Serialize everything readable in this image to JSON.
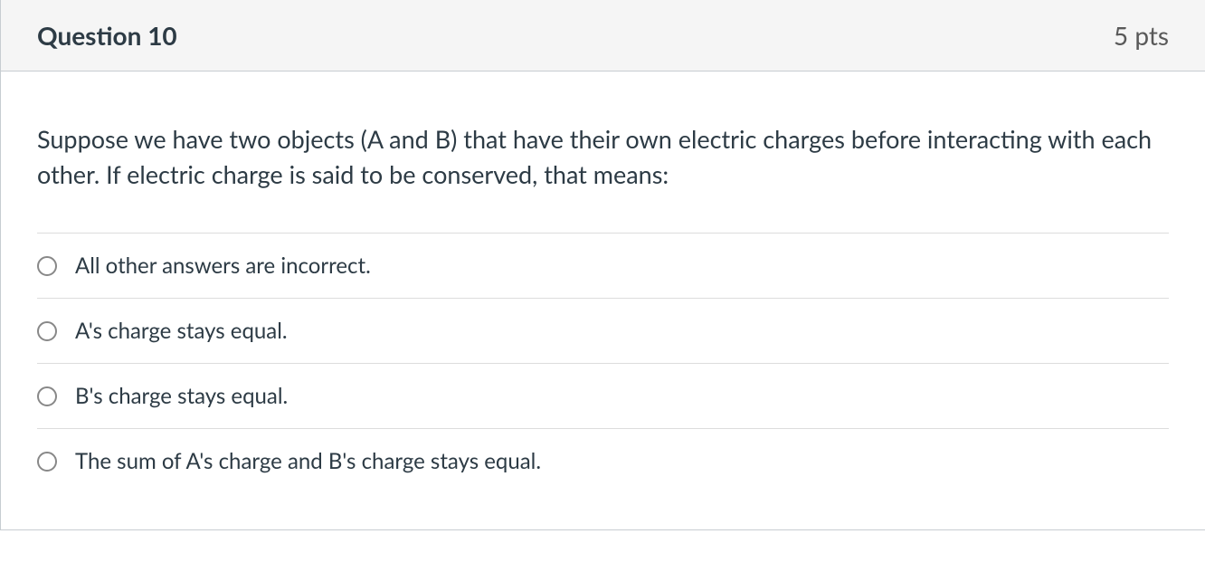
{
  "header": {
    "title": "Question 10",
    "points": "5 pts"
  },
  "question": {
    "text": "Suppose we have two objects (A and B) that have their own electric charges before interacting with each other. If electric charge is said to be conserved, that means:"
  },
  "answers": [
    {
      "label": "All other answers are incorrect."
    },
    {
      "label": "A's charge stays equal."
    },
    {
      "label": "B's charge stays equal."
    },
    {
      "label": "The sum of A's charge and B's charge stays equal."
    }
  ]
}
